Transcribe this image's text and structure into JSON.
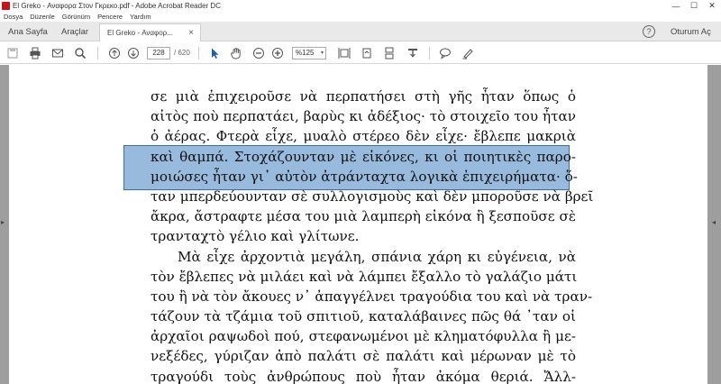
{
  "window": {
    "title": "El Greko - Αναφορα Στον Γκρεκο.pdf - Adobe Acrobat Reader DC",
    "controls": {
      "minimize": "—",
      "maximize": "☐",
      "close": "✕"
    }
  },
  "menu": [
    "Dosya",
    "Düzenle",
    "Görünüm",
    "Pencere",
    "Yardım"
  ],
  "tabs": {
    "home": "Ana Sayfa",
    "tools": "Araçlar",
    "document": "El Greko - Αναφορ...",
    "document_close": "×"
  },
  "header_right": {
    "help": "?",
    "signin": "Oturum Aç"
  },
  "toolbar": {
    "icons": [
      "save-icon",
      "print-icon",
      "email-icon",
      "search-icon",
      "page-up-icon",
      "page-down-icon",
      "select-icon",
      "hand-icon",
      "zoom-out-icon",
      "zoom-in-icon",
      "fit-page-icon",
      "rotate-icon",
      "scroll-icon",
      "stamp-icon",
      "comment-icon",
      "highlight-icon"
    ],
    "current_page": "228",
    "total_pages": "/ 620",
    "zoom": "%125",
    "zoom_caret": "▾"
  },
  "document": {
    "lines": [
      "σε μιὰ ἐπιχειροῦσε νὰ περπατήσει στὴ γῆς ἦταν ὅπως ὁ",
      "αἰτὸς ποὺ περπατάει, βαρὺς κι ἀδέξιος· τὸ στοιχεῖο του ἦταν",
      "ὁ ἀέρας. Φτερὰ εἶχε, μυαλὸ στέρεο δὲν εἶχε· ἔβλεπε μακριὰ",
      "καὶ θαμπά. Στοχάζουνταν μὲ εἰκόνες, κι οἱ ποιητικὲς παρο-",
      "μοιώσες ἦταν γι᾿ αὐτὸν ἀτράνταχτα λογικὰ ἐπιχειρήματα· ὅ-",
      "ταν μπερδεύουνταν σὲ συλλογισμοὺς καὶ δὲν μποροῦσε νὰ βρεῖ",
      "ἄκρα, ἄστραφτε μέσα του μιὰ λαμπερὴ εἰκόνα ἢ ξεσποῦσε σὲ",
      "τρανταχτὸ γέλιο καὶ γλίτωνε.",
      "Μὰ εἶχε ἀρχοντιὰ μεγάλη, σπάνια χάρη κι εὐγένεια, νὰ",
      "τὸν ἔβλεπες νὰ μιλάει καὶ νὰ λάμπει ἔξαλλο τὸ γαλάζιο μάτι",
      "του ἢ νὰ τὸν ἄκουες ν᾿ ἀπαγγέλνει τραγούδια του καὶ νὰ τραν-",
      "τάζουν τὰ τζάμια τοῦ σπιτιοῦ, καταλάβαινες πῶς θά ᾿ταν οἱ",
      "ἀρχαῖοι ραψωδοὶ πού, στεφανωμένοι μὲ κληματόφυλλα ἢ με-",
      "νεξέδες, γύριζαν ἀπὸ παλάτι σὲ παλάτι καὶ μέρωναν μὲ τὸ",
      "τραγούδι τοὺς ἀνθρώπους ποὺ ἦταν ἀκόμα θεριά. Ἄλλ-"
    ]
  }
}
